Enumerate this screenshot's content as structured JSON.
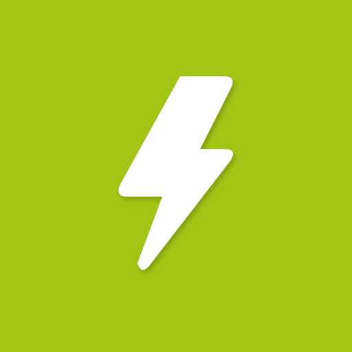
{
  "icon": {
    "name": "lightning-bolt-icon",
    "background_color": "#a3c616",
    "glyph_color": "#ffffff",
    "shadow_color": "#7f9b0f"
  }
}
